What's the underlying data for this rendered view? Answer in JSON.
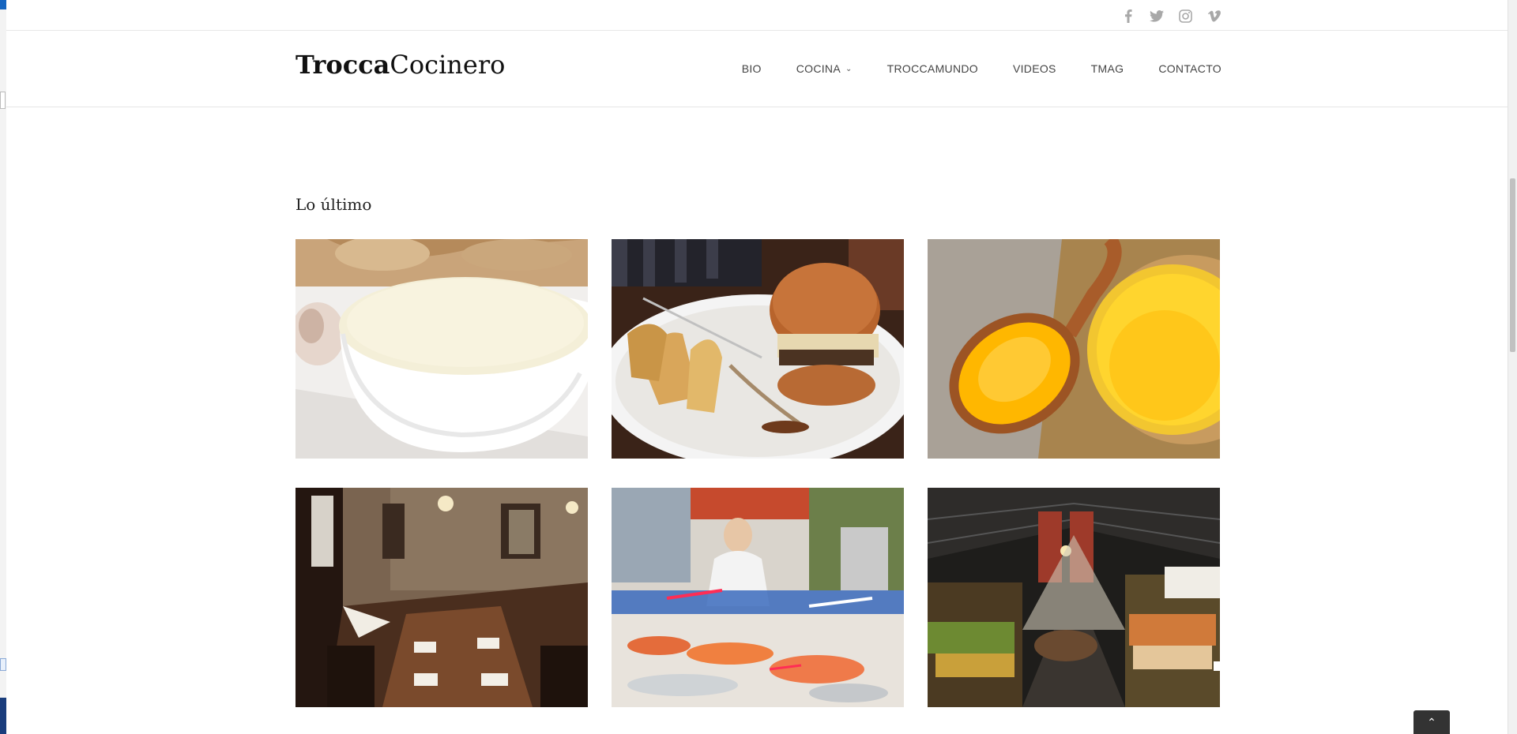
{
  "brand": {
    "logo_bold": "Trocca",
    "logo_light": "Cocinero"
  },
  "social": [
    "facebook-icon",
    "twitter-icon",
    "instagram-icon",
    "vimeo-icon"
  ],
  "nav": {
    "items": [
      {
        "label": "BIO"
      },
      {
        "label": "COCINA",
        "has_dropdown": true
      },
      {
        "label": "TROCCAMUNDO"
      },
      {
        "label": "VIDEOS"
      },
      {
        "label": "TMAG"
      },
      {
        "label": "CONTACTO"
      }
    ],
    "dropdown_glyph": "⌄"
  },
  "section": {
    "title": "Lo último"
  },
  "posts": [
    {
      "name": "post-image-soup-bowl"
    },
    {
      "name": "post-image-burger"
    },
    {
      "name": "post-image-honey-spoon"
    },
    {
      "name": "post-image-restaurant-interior"
    },
    {
      "name": "post-image-fish-market"
    },
    {
      "name": "post-image-boqueria-market"
    }
  ],
  "to_top": {
    "glyph": "⌃"
  },
  "colors": {
    "text": "#333333",
    "nav_text": "#444444",
    "border": "#e6e6e6",
    "social_icon": "#a8a8a8",
    "to_top_bg": "#333333"
  }
}
